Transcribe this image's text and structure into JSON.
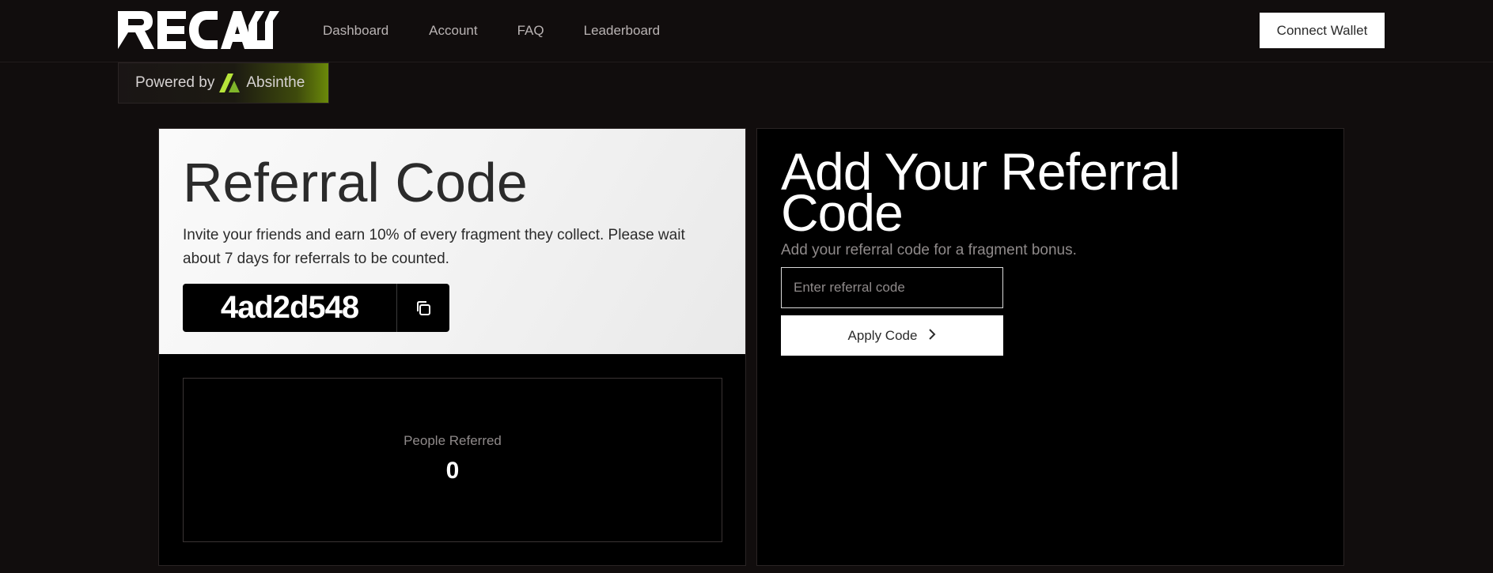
{
  "header": {
    "logo_text": "RECALL",
    "nav": [
      "Dashboard",
      "Account",
      "FAQ",
      "Leaderboard"
    ],
    "connect_wallet": "Connect Wallet"
  },
  "powered_by": {
    "label": "Powered by",
    "brand": "Absinthe"
  },
  "referral": {
    "title": "Referral Code",
    "description": "Invite your friends and earn 10% of every fragment they collect. Please wait about 7 days for referrals to be counted.",
    "code": "4ad2d548",
    "copy_icon": "copy-icon",
    "stats_label": "People Referred",
    "stats_value": "0"
  },
  "add_referral": {
    "title": "Add Your Referral Code",
    "description": "Add your referral code for a fragment bonus.",
    "input_placeholder": "Enter referral code",
    "input_value": "",
    "apply_label": "Apply Code",
    "apply_icon": "chevron-right-icon"
  },
  "colors": {
    "background": "#110d0d",
    "card_dark": "#000000",
    "card_light": "#f3f3f3",
    "accent_green": "#8bc63f"
  }
}
